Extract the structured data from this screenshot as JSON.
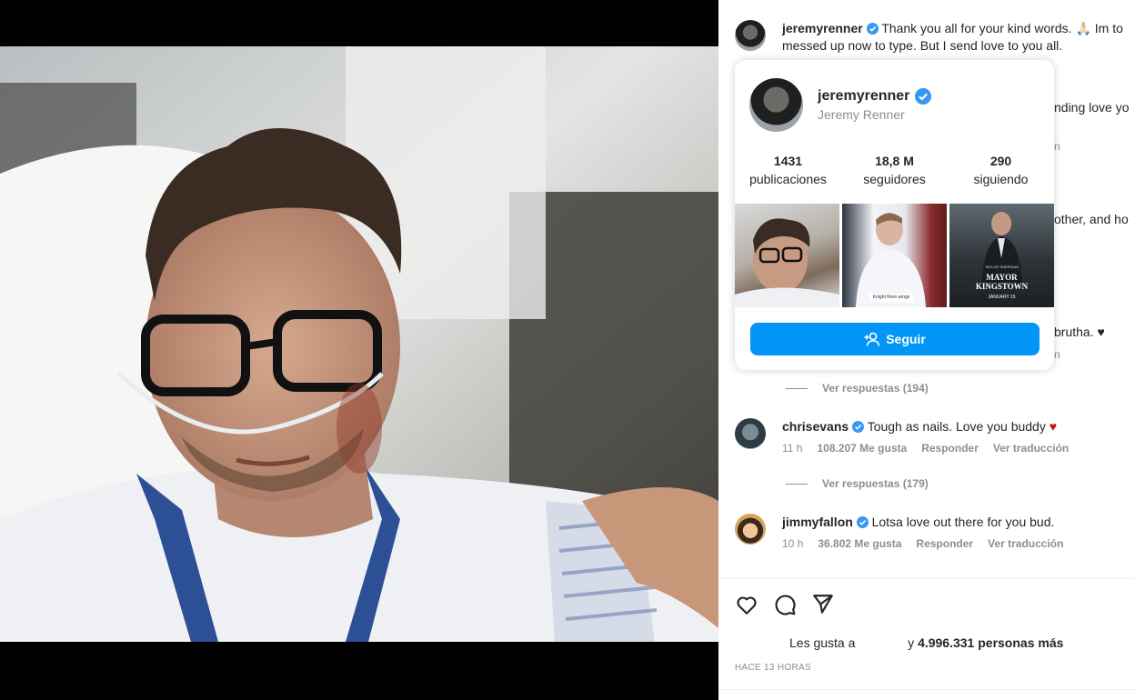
{
  "post": {
    "author": "jeremyrenner",
    "caption_text": "Thank you all for your kind words. 🙏🏻 Im to",
    "caption_line2": "messed up now to type. But I send love to you all."
  },
  "hover_card": {
    "username": "jeremyrenner",
    "full_name": "Jeremy Renner",
    "stats": [
      {
        "num": "1431",
        "label": "publicaciones"
      },
      {
        "num": "18,8 M",
        "label": "seguidores"
      },
      {
        "num": "290",
        "label": "siguiendo"
      }
    ],
    "thumb2_tag": "Knight Rare wings",
    "thumb3_top": "TAYLOR SHERIDAN",
    "thumb3_title_line1": "MAYOR",
    "thumb3_title_line2": "KINGSTOWN",
    "thumb3_sub": "JANUARY 15",
    "follow_label": "Seguir"
  },
  "partial_text": {
    "p1": "nding love yo",
    "p2": "n",
    "p3": "other, and ho",
    "p4": "brutha. ♥",
    "p5": "n"
  },
  "comments": [
    {
      "replies_label": "Ver respuestas (194)"
    },
    {
      "username": "chrisevans",
      "text": "Tough as nails. Love you buddy",
      "heart": "♥",
      "time": "11 h",
      "likes": "108.207 Me gusta",
      "reply": "Responder",
      "translate": "Ver traducción",
      "replies_label": "Ver respuestas (179)"
    },
    {
      "username": "jimmyfallon",
      "text": "Lotsa love out there for you bud.",
      "time": "10 h",
      "likes": "36.802 Me gusta",
      "reply": "Responder",
      "translate": "Ver traducción"
    }
  ],
  "likes_line": {
    "prefix": "Les gusta a",
    "connector": "y",
    "count": "4.996.331 personas más"
  },
  "time_ago": "HACE 13 HORAS",
  "colors": {
    "accent": "#0095f6",
    "verified": "#3897f0",
    "heart": "#c41414"
  }
}
